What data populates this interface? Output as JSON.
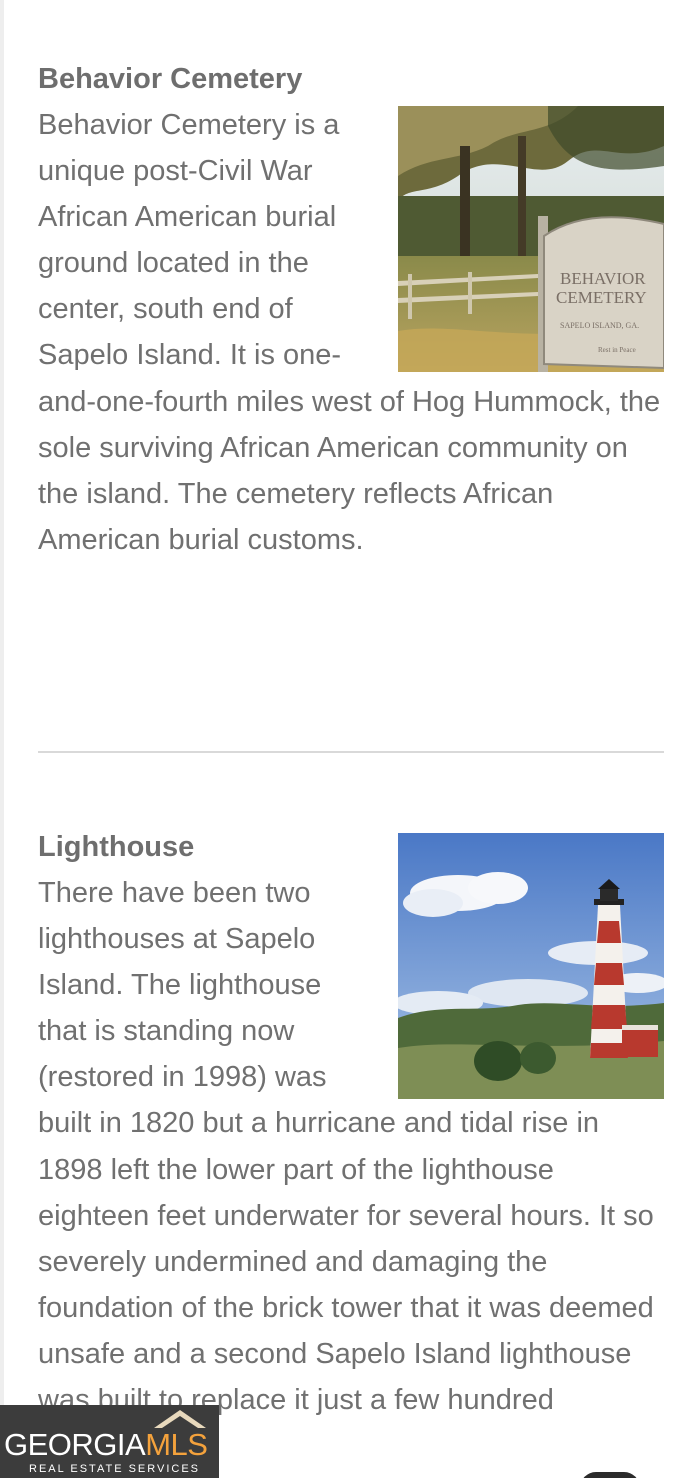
{
  "sections": [
    {
      "title": "Behavior Cemetery",
      "body": "Behavior Cemetery is a unique post-Civil War African American burial ground located in the center, south end of Sapelo Island. It is one-and-one-fourth miles west of Hog Hummock, the sole surviving African American community on the island. The cemetery reflects African American burial customs.",
      "image": {
        "subject": "wooded cemetery entrance with roadside sign",
        "sign_line1": "BEHAVIOR",
        "sign_line2": "CEMETERY",
        "sign_line3": "SAPELO ISLAND, GA.",
        "sign_line4": "Rest in Peace"
      }
    },
    {
      "title": "Lighthouse",
      "body": "There have been two lighthouses at Sapelo Island. The lighthouse that is standing now (restored in 1998) was built in 1820 but a hurricane and tidal rise in 1898 left the lower part of the lighthouse eighteen feet underwater for several hours. It so severely undermined and damaging the foundation of the brick tower that it was deemed unsafe and a second Sapelo Island lighthouse was built to replace it just a few hundred",
      "image": {
        "subject": "red and white striped lighthouse under blue sky"
      }
    }
  ],
  "watermark": {
    "brand_part1": "GEORGIA",
    "brand_part2": "MLS",
    "tagline": "REAL ESTATE SERVICES"
  },
  "colors": {
    "text": "#707070",
    "divider": "#d9d9d9",
    "watermark_bg": "#3c3c3c",
    "watermark_accent": "#f4a23c"
  }
}
